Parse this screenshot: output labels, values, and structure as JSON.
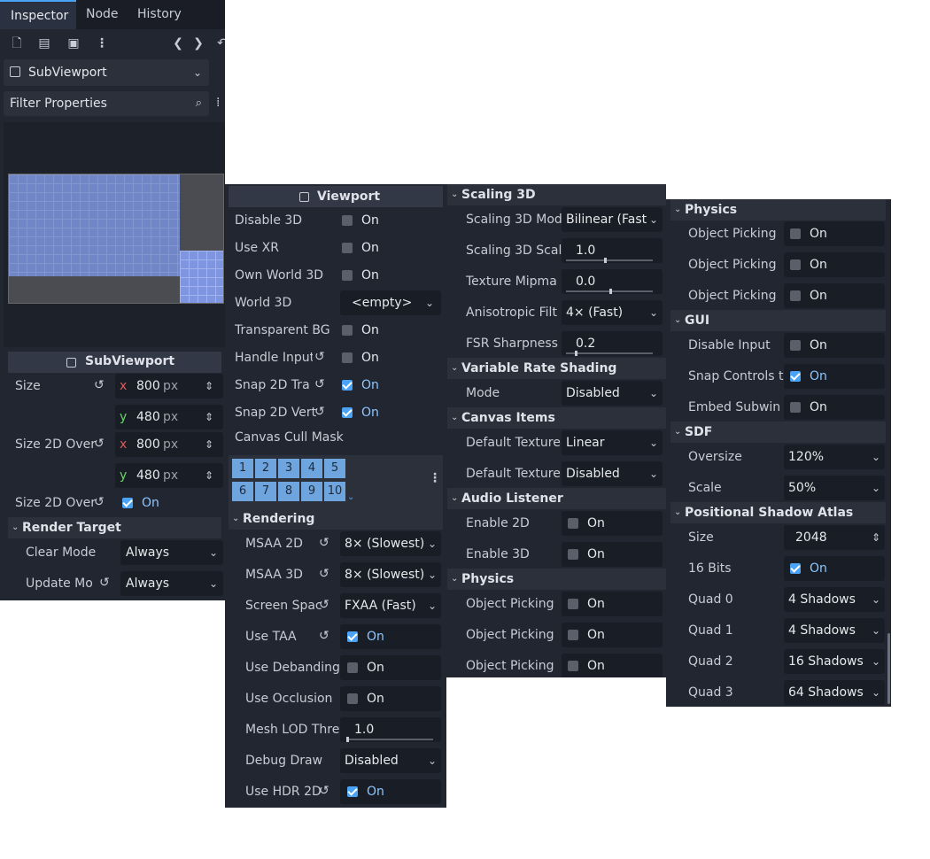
{
  "tabs": [
    "Inspector",
    "Node",
    "History"
  ],
  "toolbar_icons": [
    "new-file-icon",
    "open-folder-icon",
    "save-icon",
    "more-vertical-icon",
    "back-icon",
    "forward-icon",
    "undo-icon"
  ],
  "node_selector": {
    "label": "SubViewport"
  },
  "filter": {
    "placeholder": "Filter Properties"
  },
  "col1": {
    "subviewport_header": "SubViewport",
    "size_label": "Size",
    "size_x": "800",
    "size_y": "480",
    "size2d_label": "Size 2D Over",
    "size2d_x": "800",
    "size2d_y": "480",
    "size2d_stretch_label": "Size 2D Over",
    "x_axis": "x",
    "y_axis": "y",
    "unit": "px",
    "on": "On",
    "render_target_section": "Render Target",
    "clear_mode_label": "Clear Mode",
    "clear_mode_value": "Always",
    "update_mode_label": "Update Mo",
    "update_mode_value": "Always"
  },
  "col2": {
    "viewport_header": "Viewport",
    "on": "On",
    "disable3d": "Disable 3D",
    "use_xr": "Use XR",
    "own_world": "Own World 3D",
    "world3d": "World 3D",
    "world3d_value": "<empty>",
    "transparent_bg": "Transparent BG",
    "handle_input": "Handle Input",
    "snap2d_tra": "Snap 2D Tra",
    "snap2d_vert": "Snap 2D Vert",
    "canvas_cull": "Canvas Cull Mask",
    "mask_bits": [
      "1",
      "2",
      "3",
      "4",
      "5",
      "6",
      "7",
      "8",
      "9",
      "10"
    ],
    "rendering_section": "Rendering",
    "msaa2d": "MSAA 2D",
    "msaa2d_value": "8× (Slowest)",
    "msaa3d": "MSAA 3D",
    "msaa3d_value": "8× (Slowest)",
    "screen_space": "Screen Spac",
    "screen_space_value": "FXAA (Fast)",
    "use_taa": "Use TAA",
    "use_debanding": "Use Debanding",
    "use_occlusion": "Use Occlusion",
    "mesh_lod": "Mesh LOD Thre",
    "mesh_lod_value": "1.0",
    "debug_draw": "Debug Draw",
    "debug_draw_value": "Disabled",
    "use_hdr2d": "Use HDR 2D"
  },
  "col3": {
    "on": "On",
    "scaling_section": "Scaling 3D",
    "scaling_mode": "Scaling 3D Mod",
    "scaling_mode_value": "Bilinear (Fast",
    "scaling_scale": "Scaling 3D Scal",
    "scaling_scale_value": "1.0",
    "texture_mipmap": "Texture Mipma",
    "texture_mipmap_value": "0.0",
    "anisotropic": "Anisotropic Filt",
    "anisotropic_value": "4× (Fast)",
    "fsr": "FSR Sharpness",
    "fsr_value": "0.2",
    "vrs_section": "Variable Rate Shading",
    "mode": "Mode",
    "mode_value": "Disabled",
    "canvas_section": "Canvas Items",
    "default_texture1": "Default Texture",
    "default_texture1_value": "Linear",
    "default_texture2": "Default Texture",
    "default_texture2_value": "Disabled",
    "audio_section": "Audio Listener",
    "enable2d": "Enable 2D",
    "enable3d": "Enable 3D",
    "physics_section": "Physics",
    "object_picking": "Object Picking"
  },
  "col4": {
    "on": "On",
    "physics_section": "Physics",
    "object_picking": "Object Picking",
    "gui_section": "GUI",
    "disable_input": "Disable Input",
    "snap_controls": "Snap Controls t",
    "embed_subwin": "Embed Subwin",
    "sdf_section": "SDF",
    "oversize": "Oversize",
    "oversize_value": "120%",
    "scale": "Scale",
    "scale_value": "50%",
    "shadow_section": "Positional Shadow Atlas",
    "size": "Size",
    "size_value": "2048",
    "bits16": "16 Bits",
    "quad0": "Quad 0",
    "quad0_value": "4 Shadows",
    "quad1": "Quad 1",
    "quad1_value": "4 Shadows",
    "quad2": "Quad 2",
    "quad2_value": "16 Shadows",
    "quad3": "Quad 3",
    "quad3_value": "64 Shadows"
  },
  "colors": {
    "accent": "#4aa3f5",
    "panel": "#212631",
    "field": "#191d25"
  }
}
